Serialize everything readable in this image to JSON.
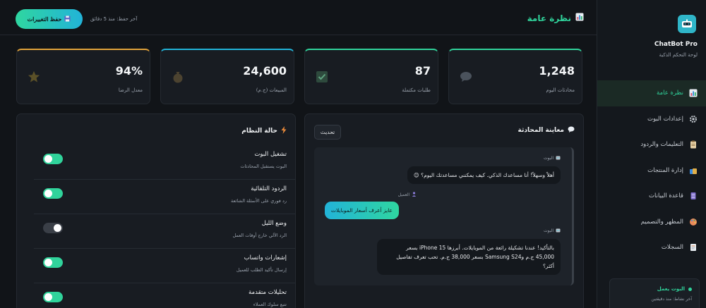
{
  "sidebar": {
    "brand": "ChatBot Pro",
    "subtitle": "لوحة التحكم الذكية",
    "items": [
      {
        "label": "نظرة عامة"
      },
      {
        "label": "إعدادات البوت"
      },
      {
        "label": "التعليمات والردود"
      },
      {
        "label": "إدارة المنتجات"
      },
      {
        "label": "قاعدة البيانات"
      },
      {
        "label": "المظهر والتصميم"
      },
      {
        "label": "السجلات"
      }
    ],
    "status": {
      "label": "البوت يعمل",
      "last_active": "آخر نشاط: منذ دقيقتين"
    }
  },
  "header": {
    "title": "نظرة عامة",
    "save_label": "حفظ التغييرات",
    "last_saved": "آخر حفظ: منذ 5 دقائق"
  },
  "stats": [
    {
      "value": "1,248",
      "label": "محادثات اليوم",
      "color": "#30d39b",
      "icon": "speech-bubble-icon"
    },
    {
      "value": "87",
      "label": "طلبات مكتملة",
      "color": "#30d39b",
      "icon": "checkbox-icon"
    },
    {
      "value": "24,600",
      "label": "المبيعات (ج.م)",
      "color": "#22b3d8",
      "icon": "money-bag-icon"
    },
    {
      "value": "94%",
      "label": "معدل الرضا",
      "color": "#e0a23a",
      "icon": "star-icon"
    }
  ],
  "chat_preview": {
    "title": "معاينة المحادثة",
    "refresh_label": "تحديث",
    "messages": [
      {
        "sender": "البوت",
        "text": "أهلاً وسهلاً! أنا مساعدك الذكي. كيف يمكنني مساعدتك اليوم؟ 😊"
      },
      {
        "sender": "العميل",
        "text": "عايز أعرف أسعار الموبايلات"
      },
      {
        "sender": "البوت",
        "lines": [
          "بالتأكيد! عندنا تشكيلة رائعة من الموبايلات. أبرزها iPhone 15 بسعر",
          "45,000 ج.م وSamsung S24 بسعر 38,000 ج.م. تحب تعرف تفاصيل",
          "أكثر؟"
        ]
      }
    ]
  },
  "system_status": {
    "title": "حالة النظام",
    "toggles": [
      {
        "title": "تشغيل البوت",
        "desc": "البوت يستقبل المحادثات",
        "on": true
      },
      {
        "title": "الردود التلقائية",
        "desc": "رد فوري على الأسئلة الشائعة",
        "on": true
      },
      {
        "title": "وضع الليل",
        "desc": "الرد الآلي خارج أوقات العمل",
        "on": false
      },
      {
        "title": "إشعارات واتساب",
        "desc": "إرسال تأكيد الطلب للعميل",
        "on": true
      },
      {
        "title": "تحليلات متقدمة",
        "desc": "تتبع سلوك العملاء",
        "on": true
      }
    ]
  }
}
